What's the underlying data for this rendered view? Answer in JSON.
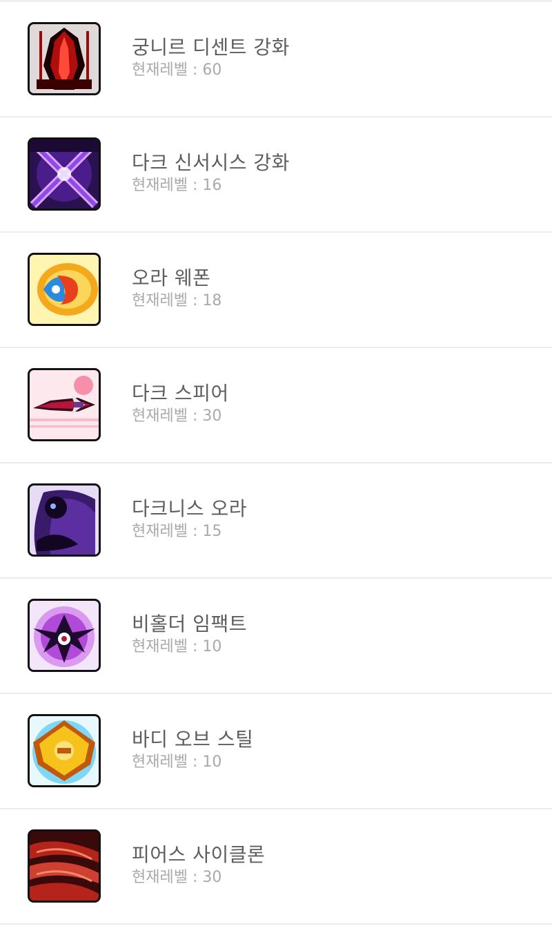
{
  "level_prefix": "현재레벨",
  "level_separator": ":",
  "skills": [
    {
      "name": "궁니르 디센트 강화",
      "level": "60",
      "icon": "gungnir-descent-icon",
      "colors": [
        "#1a0000",
        "#b00d0d",
        "#ff4a3a"
      ]
    },
    {
      "name": "다크 신서시스 강화",
      "level": "16",
      "icon": "dark-synthesis-icon",
      "colors": [
        "#1b0a33",
        "#6a2bc4",
        "#d9a5ff"
      ]
    },
    {
      "name": "오라 웨폰",
      "level": "18",
      "icon": "aura-weapon-icon",
      "colors": [
        "#fff4b0",
        "#f4a81c",
        "#e8401c"
      ]
    },
    {
      "name": "다크 스피어",
      "level": "30",
      "icon": "dark-spear-icon",
      "colors": [
        "#fde8ee",
        "#b5173c",
        "#3a0a1a"
      ]
    },
    {
      "name": "다크니스 오라",
      "level": "15",
      "icon": "darkness-aura-icon",
      "colors": [
        "#e6dcf5",
        "#3a1a6a",
        "#120622"
      ]
    },
    {
      "name": "비홀더 임팩트",
      "level": "10",
      "icon": "beholder-impact-icon",
      "colors": [
        "#f3e6fb",
        "#b14ad8",
        "#1e0a2e"
      ]
    },
    {
      "name": "바디 오브 스틸",
      "level": "10",
      "icon": "body-of-steel-icon",
      "colors": [
        "#e8f8ff",
        "#f7c21b",
        "#c0580e"
      ]
    },
    {
      "name": "피어스 사이클론",
      "level": "30",
      "icon": "pierce-cyclone-icon",
      "colors": [
        "#3a0a0a",
        "#b5241a",
        "#f08a6a"
      ]
    }
  ]
}
